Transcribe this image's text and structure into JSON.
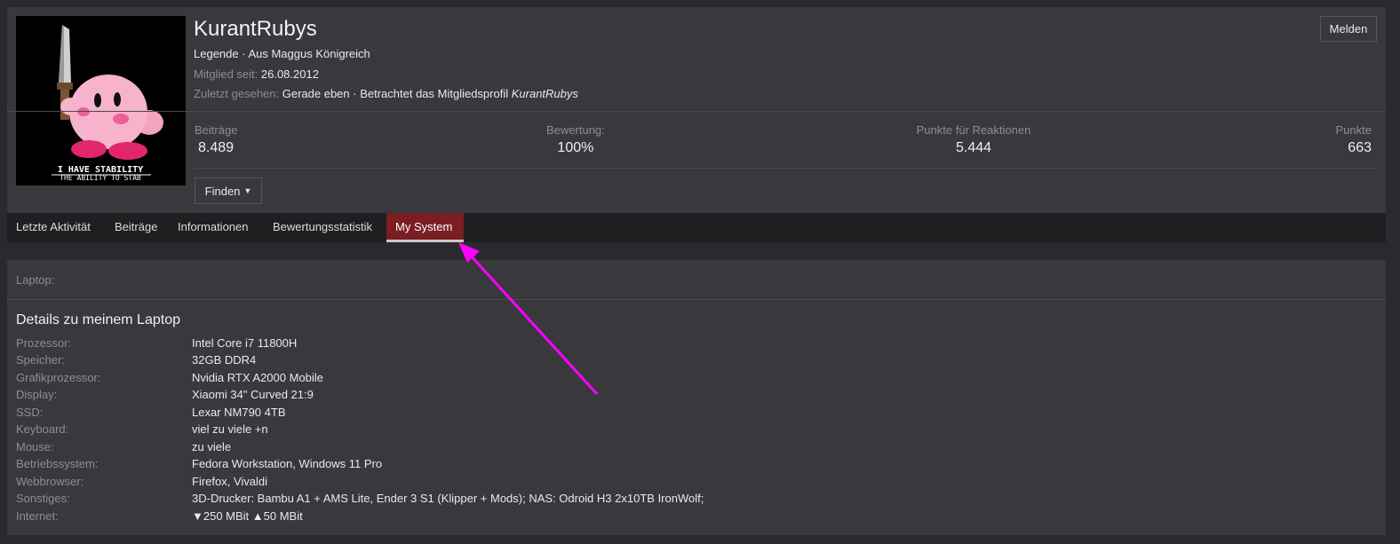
{
  "profile": {
    "username": "KurantRubys",
    "title_line": "Legende · Aus Maggus Königreich",
    "member_since_label": "Mitglied seit:",
    "member_since_value": "26.08.2012",
    "last_seen_label": "Zuletzt gesehen:",
    "last_seen_value": "Gerade eben · Betrachtet das Mitgliedsprofil",
    "last_seen_target": "KurantRubys",
    "avatar_text_1": "I HAVE STABILITY",
    "avatar_text_2": "THE ABILITY TO STAB",
    "report_label": "Melden",
    "find_label": "Finden"
  },
  "stats": [
    {
      "label": "Beiträge",
      "value": "8.489"
    },
    {
      "label": "Bewertung:",
      "value": "100%"
    },
    {
      "label": "Punkte für Reaktionen",
      "value": "5.444"
    },
    {
      "label": "Punkte",
      "value": "663"
    }
  ],
  "tabs": [
    {
      "label": "Letzte Aktivität"
    },
    {
      "label": "Beiträge"
    },
    {
      "label": "Informationen"
    },
    {
      "label": "Bewertungsstatistik"
    },
    {
      "label": "My System",
      "active": true
    }
  ],
  "system": {
    "laptop_label": "Laptop:",
    "details_title": "Details zu meinem Laptop",
    "specs": [
      {
        "key": "Prozessor:",
        "value": "Intel Core i7 11800H"
      },
      {
        "key": "Speicher:",
        "value": "32GB DDR4"
      },
      {
        "key": "Grafikprozessor:",
        "value": "Nvidia RTX A2000 Mobile"
      },
      {
        "key": "Display:",
        "value": "Xiaomi 34\" Curved 21:9"
      },
      {
        "key": "SSD:",
        "value": "Lexar NM790 4TB"
      },
      {
        "key": "Keyboard:",
        "value": "viel zu viele +n"
      },
      {
        "key": "Mouse:",
        "value": "zu viele"
      },
      {
        "key": "Betriebssystem:",
        "value": "Fedora Workstation, Windows 11 Pro"
      },
      {
        "key": "Webbrowser:",
        "value": "Firefox, Vivaldi"
      },
      {
        "key": "Sonstiges:",
        "value": "3D-Drucker: Bambu A1 + AMS Lite, Ender 3 S1 (Klipper + Mods); NAS: Odroid H3 2x10TB IronWolf;"
      },
      {
        "key": "Internet:",
        "value": "▼250 MBit ▲50 MBit"
      }
    ]
  },
  "colors": {
    "accent_tab": "#7a1e22",
    "annotation_arrow": "#ff00ff"
  },
  "icons": [
    "caret-down-icon",
    "annotation-arrow"
  ]
}
